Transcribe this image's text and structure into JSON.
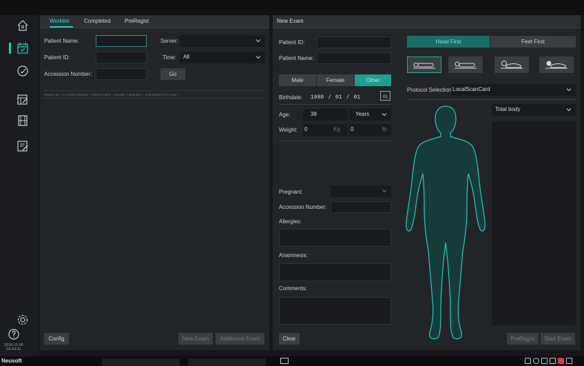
{
  "sidebar": {
    "items": [
      {
        "icon": "home-icon"
      },
      {
        "icon": "calendar-check-icon",
        "active": true
      },
      {
        "icon": "gauge-icon"
      },
      {
        "icon": "calendar-edit-icon"
      },
      {
        "icon": "film-icon"
      },
      {
        "icon": "report-edit-icon"
      }
    ],
    "bottom": [
      {
        "icon": "gear-icon"
      },
      {
        "icon": "help-icon"
      }
    ],
    "date": "2018-11-06",
    "time": "09:43:31"
  },
  "worklist": {
    "tabs": [
      {
        "label": "Worklist",
        "active": true
      },
      {
        "label": "Completed"
      },
      {
        "label": "PreRegist"
      }
    ],
    "patient_name_label": "Patient Name:",
    "patient_id_label": "Patient ID:",
    "accession_label": "Accession Number:",
    "server_label": "Server:",
    "server_value": "",
    "time_label": "Time:",
    "time_value": "All",
    "go_label": "Go",
    "columns": [
      "Patient ID",
      "Accession Number",
      "Patient Name",
      "Gender",
      "Birthdate",
      "Scheduled Exam Time"
    ],
    "config_label": "Config",
    "new_exam_label": "New Exam",
    "additional_exam_label": "Additional Exam"
  },
  "new_exam": {
    "title": "New Exam",
    "patient_id_label": "Patient ID:",
    "patient_name_label": "Patient Name:",
    "gender": {
      "male": "Male",
      "female": "Female",
      "other": "Other",
      "selected": "Other"
    },
    "birthdate_label": "Birthdate:",
    "birthdate": {
      "year": "1980",
      "month": "01",
      "day": "01",
      "sep": "/"
    },
    "calendar_day": "01",
    "age_label": "Age:",
    "age_value": "38",
    "age_unit": "Years",
    "weight_label": "Weight:",
    "weight_kg": "0",
    "weight_kg_unit": "Kg",
    "weight_lb": "0",
    "weight_lb_unit": "lb",
    "pregnant_label": "Pregnant:",
    "accession_label": "Accession Number:",
    "allergies_label": "Allergies:",
    "anamnesis_label": "Anamnesis:",
    "comments_label": "Comments:",
    "head_first_label": "Head First",
    "feet_first_label": "Feet First",
    "orientation_selected": "Head First",
    "protocol_label": "Protocol Selection:",
    "protocol_value": "LocalScanCard",
    "body_region_value": "Total body",
    "clear_label": "Clear",
    "preregist_label": "PreRegist",
    "start_exam_label": "Start Exam"
  },
  "taskbar": {
    "brand": "Neusoft"
  },
  "colors": {
    "accent": "#1fd1c1",
    "panel": "#222528",
    "background": "#15171a"
  }
}
